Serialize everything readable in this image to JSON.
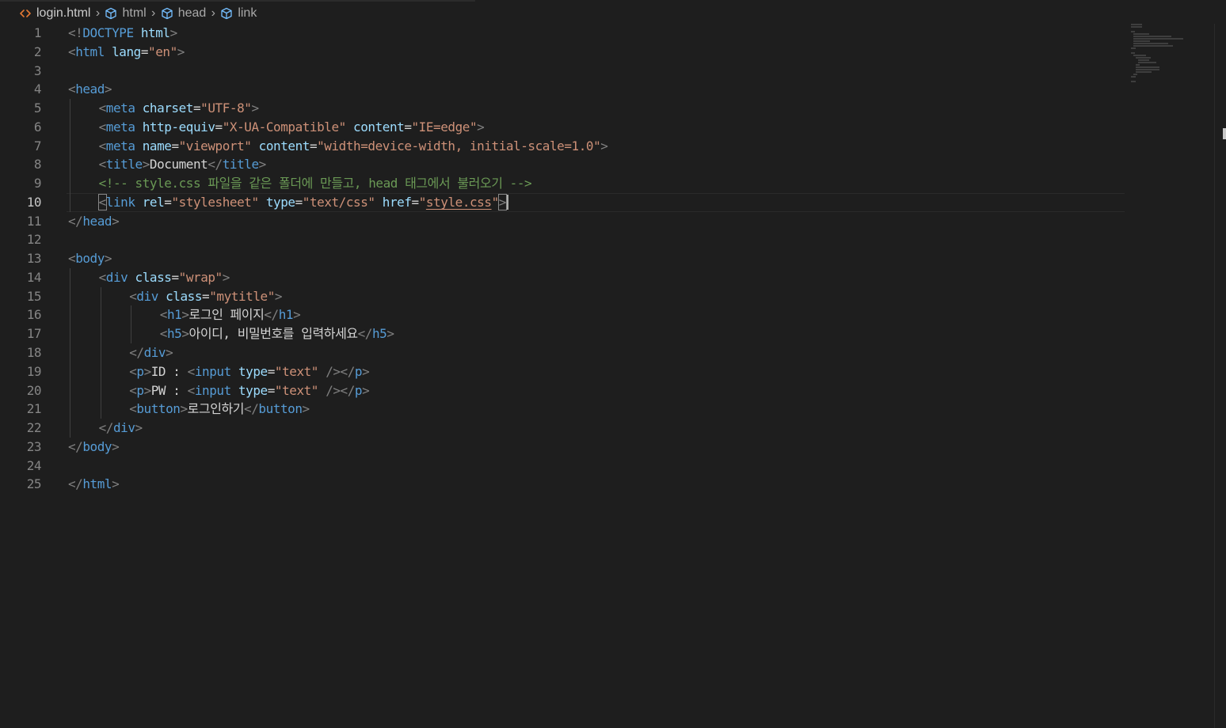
{
  "breadcrumb": {
    "file": "login.html",
    "items": [
      "html",
      "head",
      "link"
    ],
    "separator": "›",
    "colors": {
      "file_icon": "#e37933",
      "symbol_icon": "#75beff"
    }
  },
  "editor": {
    "current_line": 10,
    "theme": {
      "background": "#1e1e1e",
      "tag": "#569cd6",
      "attribute": "#9cdcfe",
      "string": "#ce9178",
      "comment": "#6a9955",
      "punctuation": "#808080"
    },
    "lines": [
      {
        "n": "1",
        "indent": 0,
        "t": [
          [
            "p",
            "<!"
          ],
          [
            "t",
            "DOCTYPE"
          ],
          [
            "x",
            " "
          ],
          [
            "a",
            "html"
          ],
          [
            "p",
            ">"
          ]
        ]
      },
      {
        "n": "2",
        "indent": 0,
        "t": [
          [
            "p",
            "<"
          ],
          [
            "t",
            "html"
          ],
          [
            "x",
            " "
          ],
          [
            "a",
            "lang"
          ],
          [
            "x",
            "="
          ],
          [
            "s",
            "\"en\""
          ],
          [
            "p",
            ">"
          ]
        ]
      },
      {
        "n": "3",
        "indent": 0,
        "t": []
      },
      {
        "n": "4",
        "indent": 0,
        "t": [
          [
            "p",
            "<"
          ],
          [
            "t",
            "head"
          ],
          [
            "p",
            ">"
          ]
        ]
      },
      {
        "n": "5",
        "indent": 1,
        "t": [
          [
            "p",
            "<"
          ],
          [
            "t",
            "meta"
          ],
          [
            "x",
            " "
          ],
          [
            "a",
            "charset"
          ],
          [
            "x",
            "="
          ],
          [
            "s",
            "\"UTF-8\""
          ],
          [
            "p",
            ">"
          ]
        ]
      },
      {
        "n": "6",
        "indent": 1,
        "t": [
          [
            "p",
            "<"
          ],
          [
            "t",
            "meta"
          ],
          [
            "x",
            " "
          ],
          [
            "a",
            "http-equiv"
          ],
          [
            "x",
            "="
          ],
          [
            "s",
            "\"X-UA-Compatible\""
          ],
          [
            "x",
            " "
          ],
          [
            "a",
            "content"
          ],
          [
            "x",
            "="
          ],
          [
            "s",
            "\"IE=edge\""
          ],
          [
            "p",
            ">"
          ]
        ]
      },
      {
        "n": "7",
        "indent": 1,
        "t": [
          [
            "p",
            "<"
          ],
          [
            "t",
            "meta"
          ],
          [
            "x",
            " "
          ],
          [
            "a",
            "name"
          ],
          [
            "x",
            "="
          ],
          [
            "s",
            "\"viewport\""
          ],
          [
            "x",
            " "
          ],
          [
            "a",
            "content"
          ],
          [
            "x",
            "="
          ],
          [
            "s",
            "\"width=device-width, initial-scale=1.0\""
          ],
          [
            "p",
            ">"
          ]
        ]
      },
      {
        "n": "8",
        "indent": 1,
        "t": [
          [
            "p",
            "<"
          ],
          [
            "t",
            "title"
          ],
          [
            "p",
            ">"
          ],
          [
            "x",
            "Document"
          ],
          [
            "p",
            "</"
          ],
          [
            "t",
            "title"
          ],
          [
            "p",
            ">"
          ]
        ]
      },
      {
        "n": "9",
        "indent": 1,
        "t": [
          [
            "c",
            "<!-- style.css 파일을 같은 폴더에 만들고, head 태그에서 불러오기 -->"
          ]
        ]
      },
      {
        "n": "10",
        "indent": 1,
        "t": [
          [
            "pb",
            "<"
          ],
          [
            "t",
            "link"
          ],
          [
            "x",
            " "
          ],
          [
            "a",
            "rel"
          ],
          [
            "x",
            "="
          ],
          [
            "s",
            "\"stylesheet\""
          ],
          [
            "x",
            " "
          ],
          [
            "a",
            "type"
          ],
          [
            "x",
            "="
          ],
          [
            "s",
            "\"text/css\""
          ],
          [
            "x",
            " "
          ],
          [
            "a",
            "href"
          ],
          [
            "x",
            "="
          ],
          [
            "s",
            "\""
          ],
          [
            "u",
            "style.css"
          ],
          [
            "s",
            "\""
          ],
          [
            "pb",
            ">"
          ]
        ]
      },
      {
        "n": "11",
        "indent": 0,
        "t": [
          [
            "p",
            "</"
          ],
          [
            "t",
            "head"
          ],
          [
            "p",
            ">"
          ]
        ]
      },
      {
        "n": "12",
        "indent": 0,
        "t": []
      },
      {
        "n": "13",
        "indent": 0,
        "t": [
          [
            "p",
            "<"
          ],
          [
            "t",
            "body"
          ],
          [
            "p",
            ">"
          ]
        ]
      },
      {
        "n": "14",
        "indent": 1,
        "t": [
          [
            "p",
            "<"
          ],
          [
            "t",
            "div"
          ],
          [
            "x",
            " "
          ],
          [
            "a",
            "class"
          ],
          [
            "x",
            "="
          ],
          [
            "s",
            "\"wrap\""
          ],
          [
            "p",
            ">"
          ]
        ]
      },
      {
        "n": "15",
        "indent": 2,
        "t": [
          [
            "p",
            "<"
          ],
          [
            "t",
            "div"
          ],
          [
            "x",
            " "
          ],
          [
            "a",
            "class"
          ],
          [
            "x",
            "="
          ],
          [
            "s",
            "\"mytitle\""
          ],
          [
            "p",
            ">"
          ]
        ]
      },
      {
        "n": "16",
        "indent": 3,
        "t": [
          [
            "p",
            "<"
          ],
          [
            "t",
            "h1"
          ],
          [
            "p",
            ">"
          ],
          [
            "x",
            "로그인 페이지"
          ],
          [
            "p",
            "</"
          ],
          [
            "t",
            "h1"
          ],
          [
            "p",
            ">"
          ]
        ]
      },
      {
        "n": "17",
        "indent": 3,
        "t": [
          [
            "p",
            "<"
          ],
          [
            "t",
            "h5"
          ],
          [
            "p",
            ">"
          ],
          [
            "x",
            "아이디, 비밀번호를 입력하세요"
          ],
          [
            "p",
            "</"
          ],
          [
            "t",
            "h5"
          ],
          [
            "p",
            ">"
          ]
        ]
      },
      {
        "n": "18",
        "indent": 2,
        "t": [
          [
            "p",
            "</"
          ],
          [
            "t",
            "div"
          ],
          [
            "p",
            ">"
          ]
        ]
      },
      {
        "n": "19",
        "indent": 2,
        "t": [
          [
            "p",
            "<"
          ],
          [
            "t",
            "p"
          ],
          [
            "p",
            ">"
          ],
          [
            "x",
            "ID : "
          ],
          [
            "p",
            "<"
          ],
          [
            "t",
            "input"
          ],
          [
            "x",
            " "
          ],
          [
            "a",
            "type"
          ],
          [
            "x",
            "="
          ],
          [
            "s",
            "\"text\""
          ],
          [
            "x",
            " "
          ],
          [
            "p",
            "/></"
          ],
          [
            "t",
            "p"
          ],
          [
            "p",
            ">"
          ]
        ]
      },
      {
        "n": "20",
        "indent": 2,
        "t": [
          [
            "p",
            "<"
          ],
          [
            "t",
            "p"
          ],
          [
            "p",
            ">"
          ],
          [
            "x",
            "PW : "
          ],
          [
            "p",
            "<"
          ],
          [
            "t",
            "input"
          ],
          [
            "x",
            " "
          ],
          [
            "a",
            "type"
          ],
          [
            "x",
            "="
          ],
          [
            "s",
            "\"text\""
          ],
          [
            "x",
            " "
          ],
          [
            "p",
            "/></"
          ],
          [
            "t",
            "p"
          ],
          [
            "p",
            ">"
          ]
        ]
      },
      {
        "n": "21",
        "indent": 2,
        "t": [
          [
            "p",
            "<"
          ],
          [
            "t",
            "button"
          ],
          [
            "p",
            ">"
          ],
          [
            "x",
            "로그인하기"
          ],
          [
            "p",
            "</"
          ],
          [
            "t",
            "button"
          ],
          [
            "p",
            ">"
          ]
        ]
      },
      {
        "n": "22",
        "indent": 1,
        "t": [
          [
            "p",
            "</"
          ],
          [
            "t",
            "div"
          ],
          [
            "p",
            ">"
          ]
        ]
      },
      {
        "n": "23",
        "indent": 0,
        "t": [
          [
            "p",
            "</"
          ],
          [
            "t",
            "body"
          ],
          [
            "p",
            ">"
          ]
        ]
      },
      {
        "n": "24",
        "indent": 0,
        "t": []
      },
      {
        "n": "25",
        "indent": 0,
        "t": [
          [
            "p",
            "</"
          ],
          [
            "t",
            "html"
          ],
          [
            "p",
            ">"
          ]
        ]
      }
    ]
  }
}
